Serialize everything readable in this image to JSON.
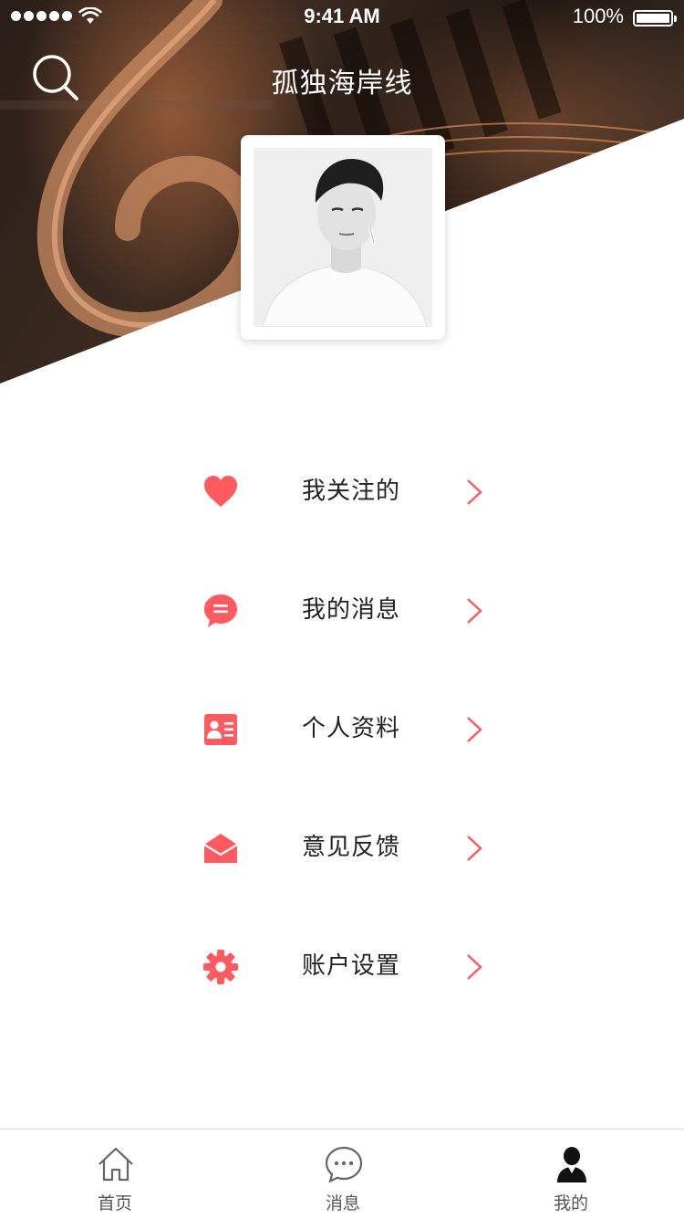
{
  "status_bar": {
    "time": "9:41 AM",
    "battery": "100%"
  },
  "header": {
    "title": "孤独海岸线"
  },
  "menu": {
    "items": [
      {
        "label": "我关注的",
        "icon": "heart-icon"
      },
      {
        "label": "我的消息",
        "icon": "message-bubble-icon"
      },
      {
        "label": "个人资料",
        "icon": "id-card-icon"
      },
      {
        "label": "意见反馈",
        "icon": "open-envelope-icon"
      },
      {
        "label": "账户设置",
        "icon": "gear-icon"
      }
    ]
  },
  "tabbar": {
    "tabs": [
      {
        "label": "首页",
        "icon": "home-icon"
      },
      {
        "label": "消息",
        "icon": "chat-icon"
      },
      {
        "label": "我的",
        "icon": "user-icon"
      }
    ]
  },
  "colors": {
    "accent": "#ff5a5f",
    "text": "#222222",
    "tab_text": "#555555"
  }
}
